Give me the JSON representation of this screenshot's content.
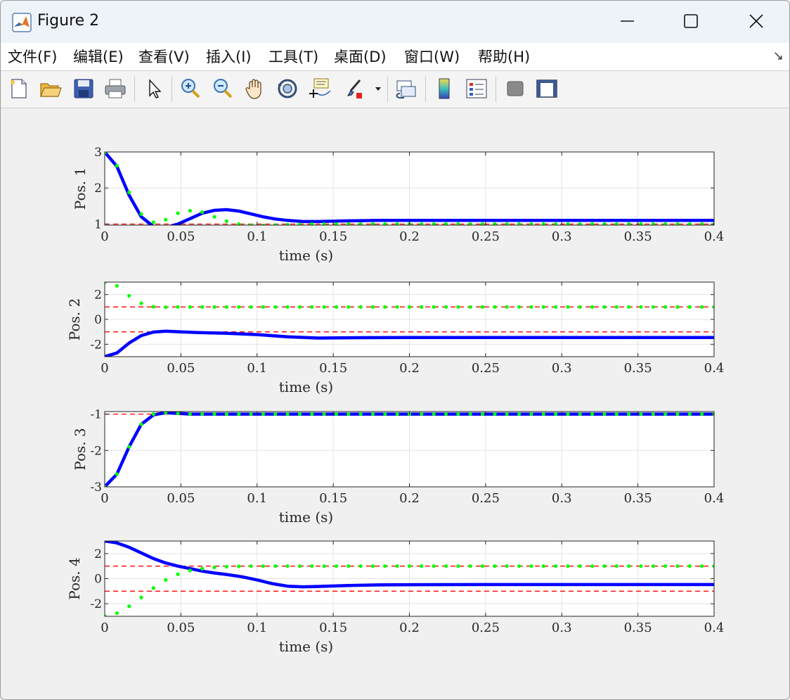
{
  "window": {
    "title": "Figure 2",
    "controls": [
      "minimize",
      "maximize",
      "close"
    ]
  },
  "menu": {
    "items": [
      "文件(F)",
      "编辑(E)",
      "查看(V)",
      "插入(I)",
      "工具(T)",
      "桌面(D)",
      "窗口(W)",
      "帮助(H)"
    ]
  },
  "toolbar": {
    "icons": [
      "new-figure-icon",
      "open-file-icon",
      "save-icon",
      "print-icon",
      "edit-plot-arrow-icon",
      "zoom-in-icon",
      "zoom-out-icon",
      "pan-hand-icon",
      "rotate-3d-icon",
      "data-cursor-icon",
      "brush-icon",
      "brush-dropdown-icon",
      "link-plot-icon",
      "colorbar-icon",
      "legend-icon",
      "hide-plot-tools-icon",
      "show-plot-tools-icon"
    ]
  },
  "colors": {
    "actual": "#0000ff",
    "reference": "#00ff00",
    "bound": "#ff0000",
    "grid": "#e3e3e3"
  },
  "chart_data": [
    {
      "type": "line",
      "ylabel": "Pos. 1",
      "xlabel": "time (s)",
      "xlim": [
        0,
        0.4
      ],
      "ylim": [
        0.97,
        3
      ],
      "xticks": [
        "0",
        "0.05",
        "0.1",
        "0.15",
        "0.2",
        "0.25",
        "0.3",
        "0.35",
        "0.4"
      ],
      "yticks": [
        1,
        2,
        3
      ],
      "bounds": [
        1
      ],
      "grid": true,
      "series": [
        {
          "role": "actual",
          "style": "solid",
          "x": [
            0,
            0.008,
            0.016,
            0.024,
            0.032,
            0.04,
            0.048,
            0.056,
            0.064,
            0.072,
            0.08,
            0.088,
            0.096,
            0.104,
            0.112,
            0.12,
            0.13,
            0.14,
            0.16,
            0.18,
            0.2,
            0.25,
            0.3,
            0.35,
            0.4
          ],
          "y": [
            3.0,
            2.6,
            1.8,
            1.2,
            0.93,
            0.9,
            1.0,
            1.15,
            1.3,
            1.38,
            1.4,
            1.36,
            1.28,
            1.2,
            1.14,
            1.1,
            1.07,
            1.07,
            1.09,
            1.1,
            1.1,
            1.1,
            1.1,
            1.1,
            1.1
          ]
        },
        {
          "role": "reference",
          "style": "dotted",
          "x": [
            0,
            0.008,
            0.016,
            0.024,
            0.032,
            0.04,
            0.048,
            0.056,
            0.064,
            0.072,
            0.08,
            0.088,
            0.096,
            0.104,
            0.112,
            0.12,
            0.128,
            0.136,
            0.144,
            0.152,
            0.16,
            0.168,
            0.176,
            0.184,
            0.192,
            0.2,
            0.208,
            0.216,
            0.224,
            0.232,
            0.24,
            0.248,
            0.256,
            0.264,
            0.272,
            0.28,
            0.288,
            0.296,
            0.304,
            0.312,
            0.32,
            0.328,
            0.336,
            0.344,
            0.352,
            0.36,
            0.368,
            0.376,
            0.384,
            0.392,
            0.4
          ],
          "y": [
            2.98,
            2.62,
            1.88,
            1.28,
            1.05,
            1.12,
            1.3,
            1.37,
            1.33,
            1.2,
            1.08,
            1.0,
            0.97,
            0.96,
            0.97,
            0.98,
            0.99,
            1.0,
            1.0,
            1.0,
            1.0,
            1.0,
            1.0,
            1.0,
            1.0,
            1.0,
            1.0,
            1.0,
            1.0,
            1.0,
            1.0,
            1.0,
            1.0,
            1.0,
            1.0,
            1.0,
            1.0,
            1.0,
            1.0,
            1.0,
            1.0,
            1.0,
            1.0,
            1.0,
            1.0,
            1.0,
            1.0,
            1.0,
            1.0,
            1.0,
            1.0
          ]
        }
      ]
    },
    {
      "type": "line",
      "ylabel": "Pos. 2",
      "xlabel": "time (s)",
      "xlim": [
        0,
        0.4
      ],
      "ylim": [
        -3,
        3
      ],
      "xticks": [
        "0",
        "0.05",
        "0.1",
        "0.15",
        "0.2",
        "0.25",
        "0.3",
        "0.35",
        "0.4"
      ],
      "yticks": [
        2,
        0,
        -2
      ],
      "bounds": [
        1,
        -1
      ],
      "grid": true,
      "series": [
        {
          "role": "actual",
          "style": "solid",
          "x": [
            0,
            0.008,
            0.016,
            0.024,
            0.032,
            0.04,
            0.05,
            0.06,
            0.08,
            0.1,
            0.12,
            0.14,
            0.16,
            0.2,
            0.25,
            0.3,
            0.35,
            0.4
          ],
          "y": [
            -3.0,
            -2.7,
            -1.9,
            -1.3,
            -1.02,
            -0.95,
            -1.0,
            -1.05,
            -1.12,
            -1.22,
            -1.4,
            -1.5,
            -1.48,
            -1.46,
            -1.46,
            -1.46,
            -1.46,
            -1.46
          ]
        },
        {
          "role": "reference",
          "style": "dotted",
          "x": [
            0,
            0.008,
            0.016,
            0.024,
            0.032,
            0.04,
            0.048,
            0.056,
            0.064,
            0.072,
            0.08,
            0.088,
            0.096,
            0.104,
            0.112,
            0.12,
            0.128,
            0.136,
            0.144,
            0.152,
            0.16,
            0.168,
            0.176,
            0.184,
            0.192,
            0.2,
            0.208,
            0.216,
            0.224,
            0.232,
            0.24,
            0.248,
            0.256,
            0.264,
            0.272,
            0.28,
            0.288,
            0.296,
            0.304,
            0.312,
            0.32,
            0.328,
            0.336,
            0.344,
            0.352,
            0.36,
            0.368,
            0.376,
            0.384,
            0.392,
            0.4
          ],
          "y": [
            3.0,
            2.7,
            1.9,
            1.3,
            1.02,
            0.98,
            1.0,
            1.0,
            1.0,
            1.0,
            1.0,
            1.0,
            1.0,
            1.0,
            1.0,
            1.0,
            1.0,
            1.0,
            1.0,
            1.0,
            1.0,
            1.0,
            1.0,
            1.0,
            1.0,
            1.0,
            1.0,
            1.0,
            1.0,
            1.0,
            1.0,
            1.0,
            1.0,
            1.0,
            1.0,
            1.0,
            1.0,
            1.0,
            1.0,
            1.0,
            1.0,
            1.0,
            1.0,
            1.0,
            1.0,
            1.0,
            1.0,
            1.0,
            1.0,
            1.0,
            1.0
          ]
        }
      ]
    },
    {
      "type": "line",
      "ylabel": "Pos. 3",
      "xlabel": "time (s)",
      "xlim": [
        0,
        0.4
      ],
      "ylim": [
        -3,
        -0.93
      ],
      "xticks": [
        "0",
        "0.05",
        "0.1",
        "0.15",
        "0.2",
        "0.25",
        "0.3",
        "0.35",
        "0.4"
      ],
      "yticks": [
        -1,
        -2,
        -3
      ],
      "bounds": [
        -1
      ],
      "grid": true,
      "series": [
        {
          "role": "actual",
          "style": "solid",
          "x": [
            0,
            0.008,
            0.016,
            0.024,
            0.032,
            0.04,
            0.048,
            0.056,
            0.064,
            0.08,
            0.1,
            0.2,
            0.3,
            0.4
          ],
          "y": [
            -3.0,
            -2.65,
            -1.9,
            -1.28,
            -1.02,
            -0.96,
            -0.98,
            -1.0,
            -1.0,
            -1.0,
            -1.0,
            -1.0,
            -1.0,
            -1.0
          ]
        },
        {
          "role": "reference",
          "style": "dotted",
          "x": [
            0,
            0.008,
            0.016,
            0.024,
            0.032,
            0.04,
            0.048,
            0.056,
            0.064,
            0.072,
            0.08,
            0.088,
            0.096,
            0.104,
            0.112,
            0.12,
            0.128,
            0.136,
            0.144,
            0.152,
            0.16,
            0.168,
            0.176,
            0.184,
            0.192,
            0.2,
            0.208,
            0.216,
            0.224,
            0.232,
            0.24,
            0.248,
            0.256,
            0.264,
            0.272,
            0.28,
            0.288,
            0.296,
            0.304,
            0.312,
            0.32,
            0.328,
            0.336,
            0.344,
            0.352,
            0.36,
            0.368,
            0.376,
            0.384,
            0.392,
            0.4
          ],
          "y": [
            -3.0,
            -2.65,
            -1.9,
            -1.28,
            -1.0,
            -0.96,
            -0.98,
            -1.0,
            -1.0,
            -1.0,
            -1.0,
            -1.0,
            -1.0,
            -1.0,
            -1.0,
            -1.0,
            -1.0,
            -1.0,
            -1.0,
            -1.0,
            -1.0,
            -1.0,
            -1.0,
            -1.0,
            -1.0,
            -1.0,
            -1.0,
            -1.0,
            -1.0,
            -1.0,
            -1.0,
            -1.0,
            -1.0,
            -1.0,
            -1.0,
            -1.0,
            -1.0,
            -1.0,
            -1.0,
            -1.0,
            -1.0,
            -1.0,
            -1.0,
            -1.0,
            -1.0,
            -1.0,
            -1.0,
            -1.0,
            -1.0,
            -1.0,
            -1.0
          ]
        }
      ]
    },
    {
      "type": "line",
      "ylabel": "Pos. 4",
      "xlabel": "time (s)",
      "xlim": [
        0,
        0.4
      ],
      "ylim": [
        -3,
        3
      ],
      "xticks": [
        "0",
        "0.05",
        "0.1",
        "0.15",
        "0.2",
        "0.25",
        "0.3",
        "0.35",
        "0.4"
      ],
      "yticks": [
        2,
        0,
        -2
      ],
      "bounds": [
        1,
        -1
      ],
      "grid": true,
      "series": [
        {
          "role": "actual",
          "style": "solid",
          "x": [
            0,
            0.008,
            0.016,
            0.024,
            0.032,
            0.04,
            0.048,
            0.056,
            0.064,
            0.072,
            0.08,
            0.09,
            0.1,
            0.11,
            0.12,
            0.13,
            0.14,
            0.16,
            0.18,
            0.2,
            0.25,
            0.3,
            0.35,
            0.4
          ],
          "y": [
            3.0,
            2.85,
            2.5,
            2.05,
            1.6,
            1.25,
            1.0,
            0.8,
            0.6,
            0.45,
            0.33,
            0.15,
            -0.1,
            -0.4,
            -0.6,
            -0.65,
            -0.62,
            -0.55,
            -0.5,
            -0.48,
            -0.47,
            -0.47,
            -0.47,
            -0.47
          ]
        },
        {
          "role": "reference",
          "style": "dotted",
          "x": [
            0,
            0.008,
            0.016,
            0.024,
            0.032,
            0.04,
            0.048,
            0.056,
            0.064,
            0.072,
            0.08,
            0.088,
            0.096,
            0.104,
            0.112,
            0.12,
            0.128,
            0.136,
            0.144,
            0.152,
            0.16,
            0.168,
            0.176,
            0.184,
            0.192,
            0.2,
            0.208,
            0.216,
            0.224,
            0.232,
            0.24,
            0.248,
            0.256,
            0.264,
            0.272,
            0.28,
            0.288,
            0.296,
            0.304,
            0.312,
            0.32,
            0.328,
            0.336,
            0.344,
            0.352,
            0.36,
            0.368,
            0.376,
            0.384,
            0.392,
            0.4
          ],
          "y": [
            -3.0,
            -2.75,
            -2.2,
            -1.5,
            -0.75,
            -0.1,
            0.35,
            0.65,
            0.8,
            0.9,
            0.95,
            0.98,
            1.0,
            1.0,
            1.0,
            1.0,
            1.0,
            1.0,
            1.0,
            1.0,
            1.0,
            1.0,
            1.0,
            1.0,
            1.0,
            1.0,
            1.0,
            1.0,
            1.0,
            1.0,
            1.0,
            1.0,
            1.0,
            1.0,
            1.0,
            1.0,
            1.0,
            1.0,
            1.0,
            1.0,
            1.0,
            1.0,
            1.0,
            1.0,
            1.0,
            1.0,
            1.0,
            1.0,
            1.0,
            1.0,
            1.0
          ]
        }
      ]
    }
  ]
}
